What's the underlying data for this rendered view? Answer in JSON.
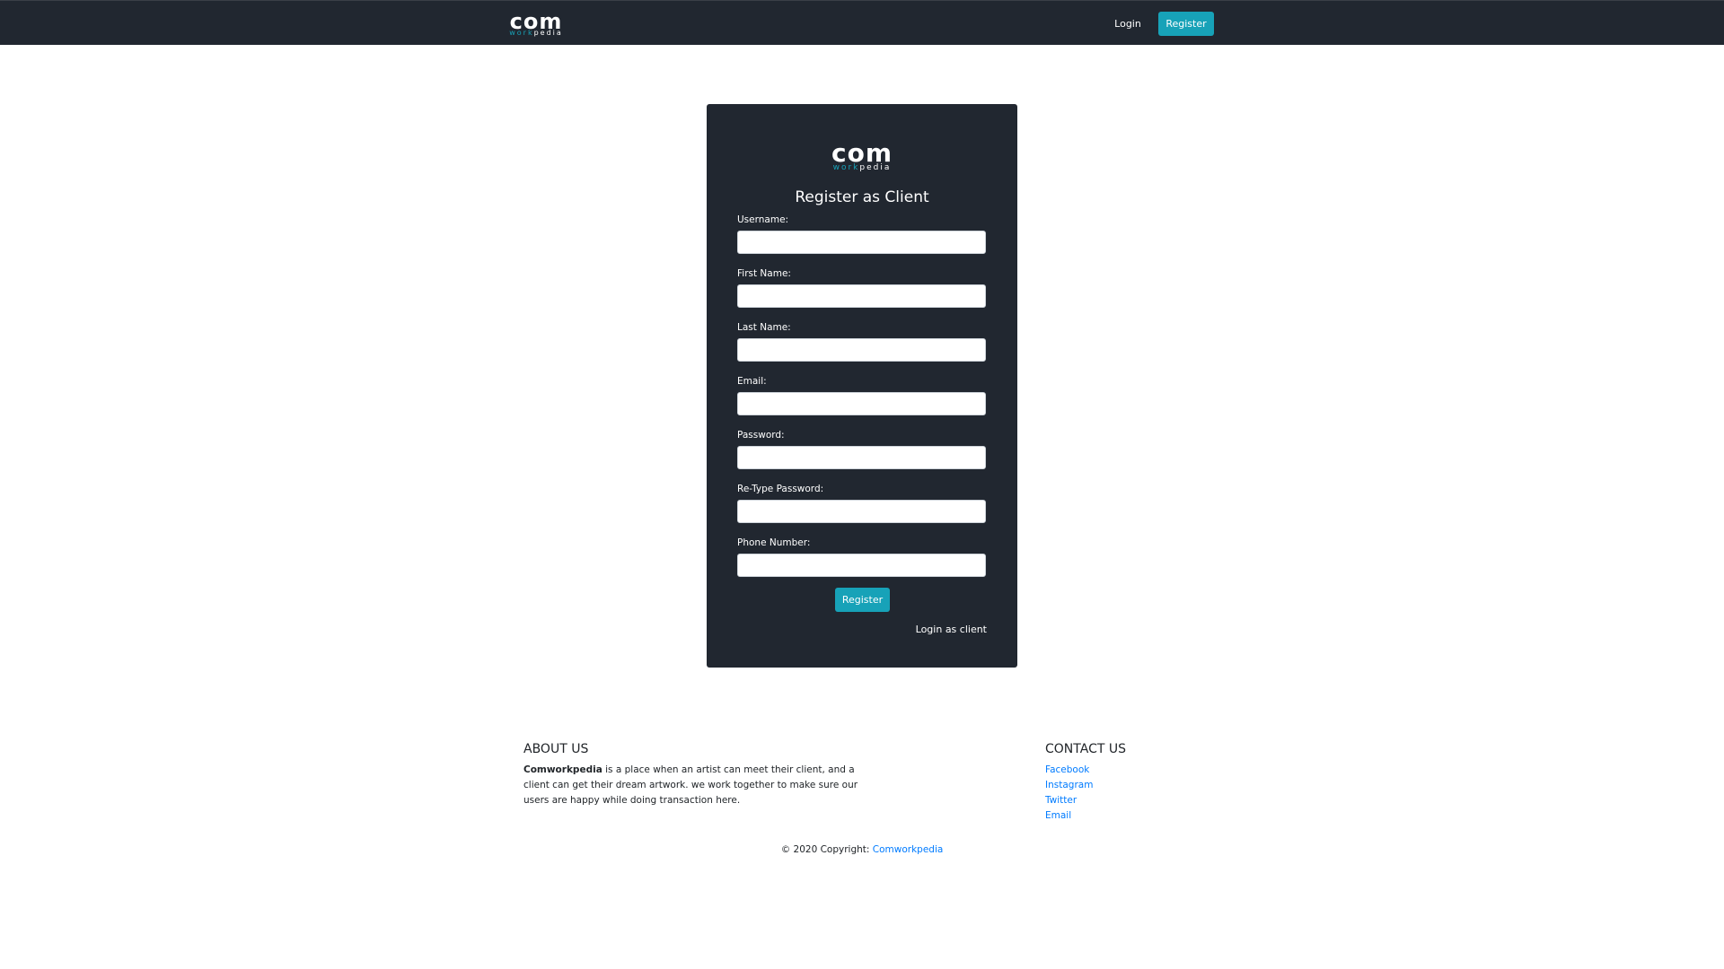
{
  "colors": {
    "navbar_bg": "#212730",
    "accent": "#17a2b8",
    "link": "#007bff"
  },
  "navbar": {
    "logo_main": "com",
    "logo_sub_teal": "work",
    "logo_sub_white": "pedia",
    "login_label": "Login",
    "register_label": "Register"
  },
  "form": {
    "logo_main": "com",
    "logo_sub_teal": "work",
    "logo_sub_white": "pedia",
    "title": "Register as Client",
    "fields": [
      {
        "label": "Username:",
        "value": ""
      },
      {
        "label": "First Name:",
        "value": ""
      },
      {
        "label": "Last Name:",
        "value": ""
      },
      {
        "label": "Email:",
        "value": ""
      },
      {
        "label": "Password:",
        "value": ""
      },
      {
        "label": "Re-Type Password:",
        "value": ""
      },
      {
        "label": "Phone Number:",
        "value": ""
      }
    ],
    "submit_label": "Register",
    "login_link": "Login as client"
  },
  "footer": {
    "about_heading": "ABOUT US",
    "about_brand": "Comworkpedia",
    "about_text": " is a place when an artist can meet their client, and a client can get their dream artwork. we work together to make sure our users are happy while doing transaction here.",
    "contact_heading": "CONTACT US",
    "contact_links": [
      "Facebook",
      "Instagram",
      "Twitter",
      "Email"
    ],
    "copyright_prefix": "© 2020 Copyright: ",
    "copyright_link": "Comworkpedia"
  }
}
